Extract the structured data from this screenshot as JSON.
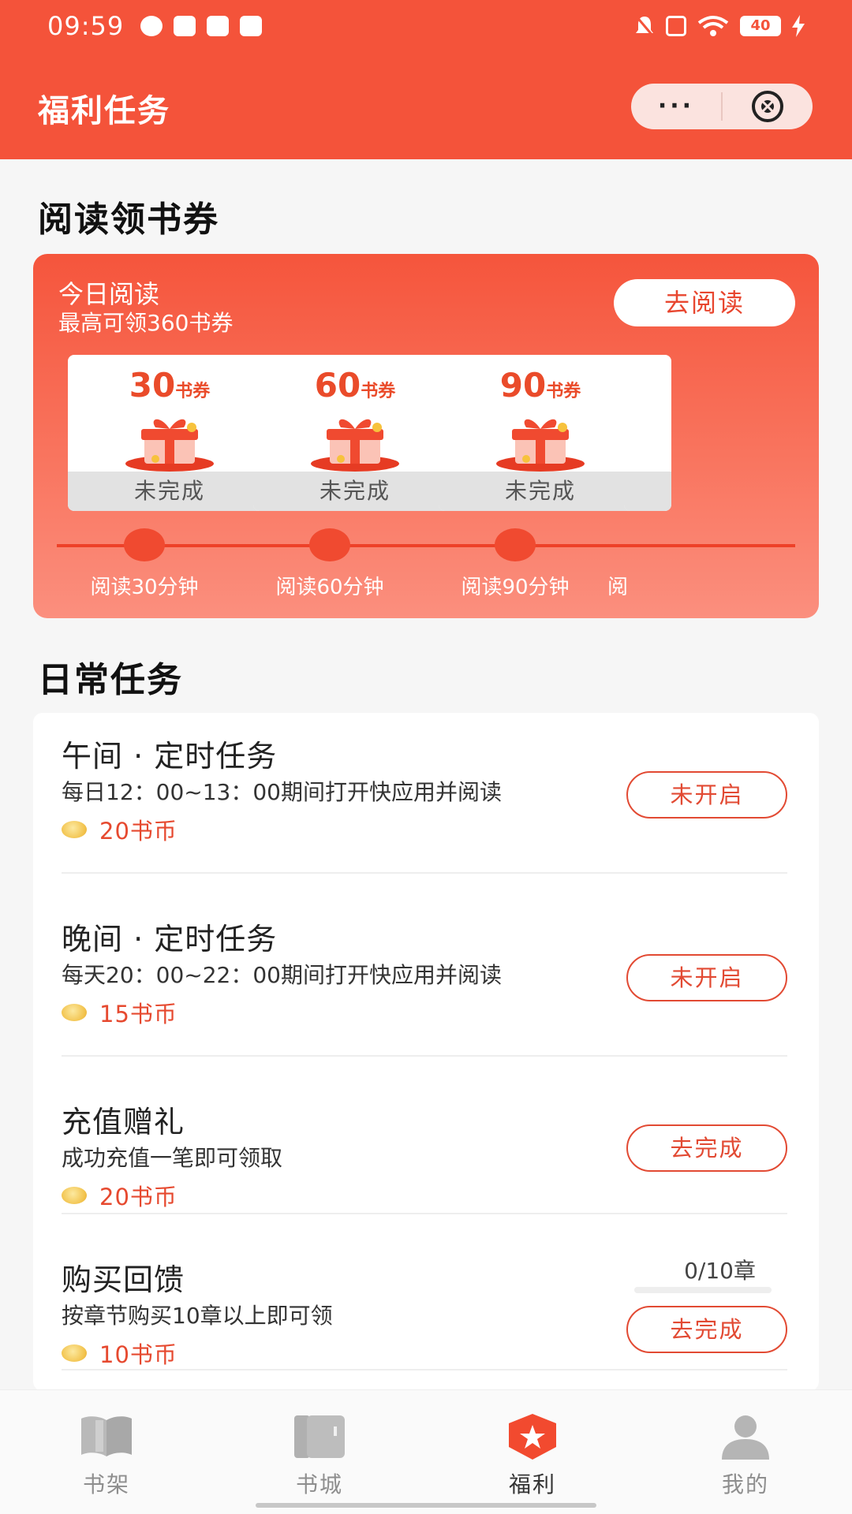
{
  "status_bar": {
    "time": "09:59",
    "battery": "40"
  },
  "header": {
    "title": "福利任务",
    "more_label": "···"
  },
  "reading_section": {
    "title": "阅读领书券",
    "card_title": "今日阅读",
    "card_subtitle": "最高可领360书券",
    "go_read_label": "去阅读",
    "rewards": [
      {
        "amount": "30",
        "unit": "书券",
        "status": "未完成",
        "milestone": "阅读30分钟"
      },
      {
        "amount": "60",
        "unit": "书券",
        "status": "未完成",
        "milestone": "阅读60分钟"
      },
      {
        "amount": "90",
        "unit": "书券",
        "status": "未完成",
        "milestone": "阅读90分钟"
      }
    ],
    "partial_milestone": "阅"
  },
  "daily_section": {
    "title": "日常任务",
    "tasks": [
      {
        "name": "午间 · 定时任务",
        "desc": "每日12：00~13：00期间打开快应用并阅读",
        "reward": "20书币",
        "button": "未开启"
      },
      {
        "name": "晚间 · 定时任务",
        "desc": "每天20：00~22：00期间打开快应用并阅读",
        "reward": "15书币",
        "button": "未开启"
      },
      {
        "name": "充值赠礼",
        "desc": "成功充值一笔即可领取",
        "reward": "20书币",
        "button": "去完成"
      },
      {
        "name": "购买回馈",
        "desc": "按章节购买10章以上即可领",
        "reward": "10书币",
        "button": "去完成",
        "progress": "0/10章",
        "progress_fraction": 0
      }
    ]
  },
  "bottom_nav": [
    {
      "label": "书架",
      "icon": "book-open-icon"
    },
    {
      "label": "书城",
      "icon": "bookstore-icon"
    },
    {
      "label": "福利",
      "icon": "star-badge-icon",
      "active": true
    },
    {
      "label": "我的",
      "icon": "person-icon"
    }
  ],
  "colors": {
    "accent": "#f4533a",
    "reward_text": "#e6492f",
    "coin": "#f2c24b"
  }
}
